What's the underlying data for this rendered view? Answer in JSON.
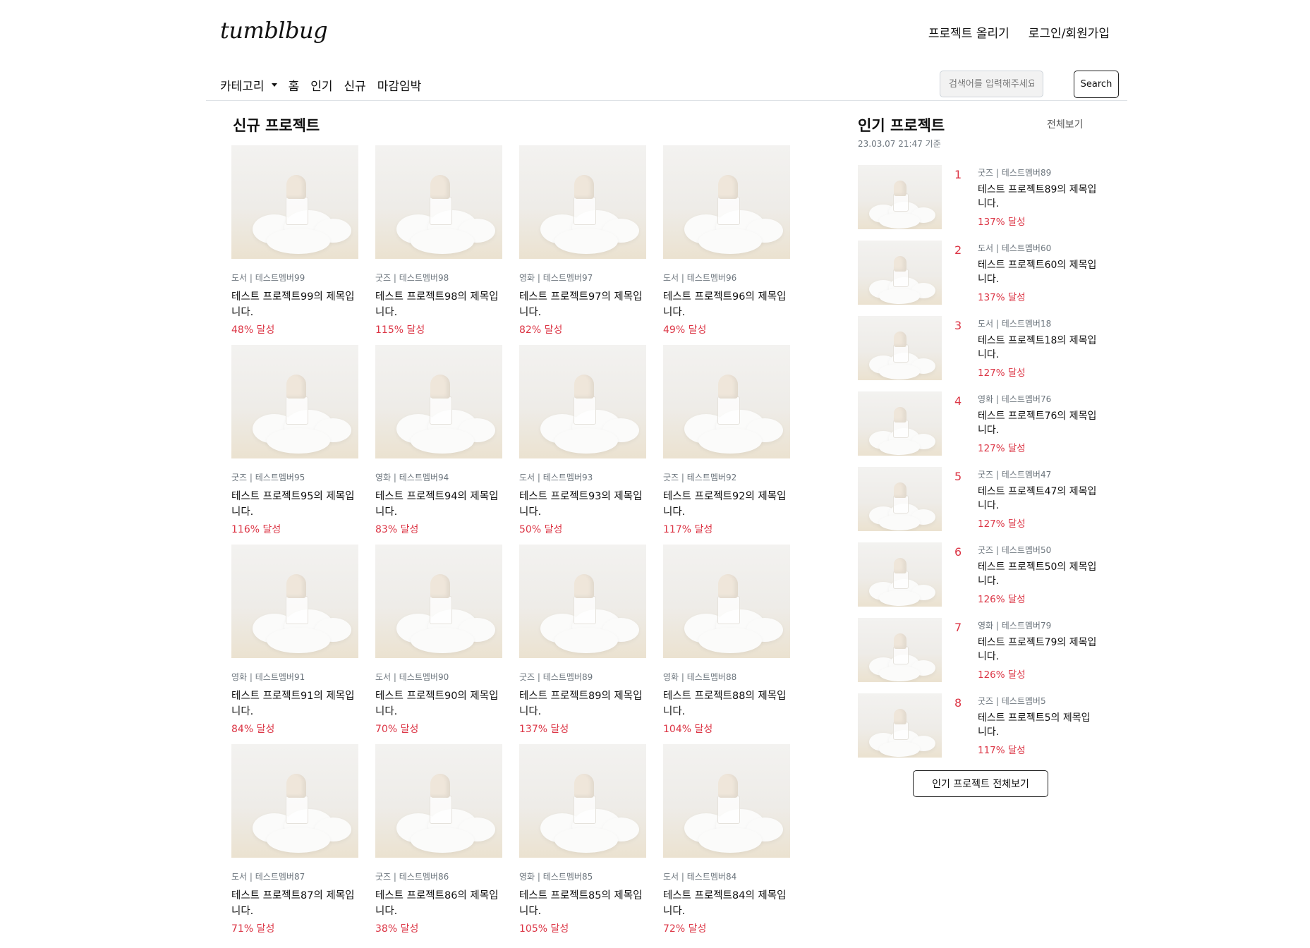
{
  "header": {
    "logo": "tumblbug",
    "links": [
      "프로젝트 올리기",
      "로그인/회원가입"
    ]
  },
  "nav": {
    "category_label": "카테고리",
    "items": [
      "홈",
      "인기",
      "신규",
      "마감임박"
    ]
  },
  "search": {
    "placeholder": "검색어를 입력해주세요.",
    "button_label": "Search"
  },
  "new_projects": {
    "title": "신규 프로젝트",
    "items": [
      {
        "meta": "도서 | 테스트멤버99",
        "title": "테스트 프로젝트99의 제목입니다.",
        "rate": "48% 달성"
      },
      {
        "meta": "굿즈 | 테스트멤버98",
        "title": "테스트 프로젝트98의 제목입니다.",
        "rate": "115% 달성"
      },
      {
        "meta": "영화 | 테스트멤버97",
        "title": "테스트 프로젝트97의 제목입니다.",
        "rate": "82% 달성"
      },
      {
        "meta": "도서 | 테스트멤버96",
        "title": "테스트 프로젝트96의 제목입니다.",
        "rate": "49% 달성"
      },
      {
        "meta": "굿즈 | 테스트멤버95",
        "title": "테스트 프로젝트95의 제목입니다.",
        "rate": "116% 달성"
      },
      {
        "meta": "영화 | 테스트멤버94",
        "title": "테스트 프로젝트94의 제목입니다.",
        "rate": "83% 달성"
      },
      {
        "meta": "도서 | 테스트멤버93",
        "title": "테스트 프로젝트93의 제목입니다.",
        "rate": "50% 달성"
      },
      {
        "meta": "굿즈 | 테스트멤버92",
        "title": "테스트 프로젝트92의 제목입니다.",
        "rate": "117% 달성"
      },
      {
        "meta": "영화 | 테스트멤버91",
        "title": "테스트 프로젝트91의 제목입니다.",
        "rate": "84% 달성"
      },
      {
        "meta": "도서 | 테스트멤버90",
        "title": "테스트 프로젝트90의 제목입니다.",
        "rate": "70% 달성"
      },
      {
        "meta": "굿즈 | 테스트멤버89",
        "title": "테스트 프로젝트89의 제목입니다.",
        "rate": "137% 달성"
      },
      {
        "meta": "영화 | 테스트멤버88",
        "title": "테스트 프로젝트88의 제목입니다.",
        "rate": "104% 달성"
      },
      {
        "meta": "도서 | 테스트멤버87",
        "title": "테스트 프로젝트87의 제목입니다.",
        "rate": "71% 달성"
      },
      {
        "meta": "굿즈 | 테스트멤버86",
        "title": "테스트 프로젝트86의 제목입니다.",
        "rate": "38% 달성"
      },
      {
        "meta": "영화 | 테스트멤버85",
        "title": "테스트 프로젝트85의 제목입니다.",
        "rate": "105% 달성"
      },
      {
        "meta": "도서 | 테스트멤버84",
        "title": "테스트 프로젝트84의 제목입니다.",
        "rate": "72% 달성"
      }
    ]
  },
  "popular_projects": {
    "title": "인기 프로젝트",
    "view_all_link": "전체보기",
    "timestamp": "23.03.07 21:47 기준",
    "view_all_button": "인기 프로젝트 전체보기",
    "items": [
      {
        "rank": "1",
        "meta": "굿즈 | 테스트멤버89",
        "title": "테스트 프로젝트89의 제목입니다.",
        "rate": "137% 달성"
      },
      {
        "rank": "2",
        "meta": "도서 | 테스트멤버60",
        "title": "테스트 프로젝트60의 제목입니다.",
        "rate": "137% 달성"
      },
      {
        "rank": "3",
        "meta": "도서 | 테스트멤버18",
        "title": "테스트 프로젝트18의 제목입니다.",
        "rate": "127% 달성"
      },
      {
        "rank": "4",
        "meta": "영화 | 테스트멤버76",
        "title": "테스트 프로젝트76의 제목입니다.",
        "rate": "127% 달성"
      },
      {
        "rank": "5",
        "meta": "굿즈 | 테스트멤버47",
        "title": "테스트 프로젝트47의 제목입니다.",
        "rate": "127% 달성"
      },
      {
        "rank": "6",
        "meta": "굿즈 | 테스트멤버50",
        "title": "테스트 프로젝트50의 제목입니다.",
        "rate": "126% 달성"
      },
      {
        "rank": "7",
        "meta": "영화 | 테스트멤버79",
        "title": "테스트 프로젝트79의 제목입니다.",
        "rate": "126% 달성"
      },
      {
        "rank": "8",
        "meta": "굿즈 | 테스트멤버5",
        "title": "테스트 프로젝트5의 제목입니다.",
        "rate": "117% 달성"
      }
    ]
  },
  "colors": {
    "accent_red": "#dc3545",
    "muted_text": "#6c757d",
    "border": "#dee2e6"
  }
}
